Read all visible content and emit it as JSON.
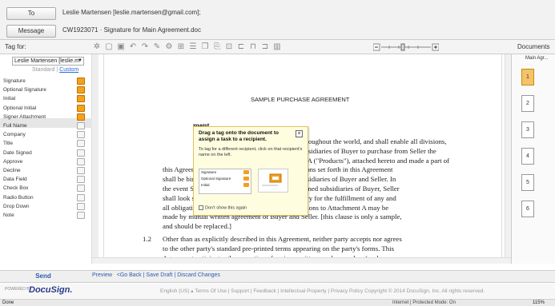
{
  "header": {
    "to_label": "To",
    "to_value": "Leslie Martensen [leslie.martensen@gmail.com];",
    "message_label": "Message",
    "message_value": "CW1923071 · Signature for Main Agreement.doc"
  },
  "toolbar": {
    "tag_for_label": "Tag for:",
    "documents_label": "Documents"
  },
  "left_panel": {
    "recipient_select": "Leslie Martensen [leslie.m",
    "tab_standard": "Standard",
    "tab_custom": "Custom",
    "tags": [
      {
        "label": "Signature",
        "icon": "sign-tag-icon"
      },
      {
        "label": "Optional Signature",
        "icon": "optional-sign-tag-icon"
      },
      {
        "label": "Initial",
        "icon": "initial-tag-icon"
      },
      {
        "label": "Optional Initial",
        "icon": "optional-initial-tag-icon"
      },
      {
        "label": "Signer Attachment",
        "icon": "attachment-tag-icon"
      },
      {
        "label": "Full Name",
        "icon": "fullname-tag-icon"
      },
      {
        "label": "Company",
        "icon": "company-tag-icon"
      },
      {
        "label": "Title",
        "icon": "title-tag-icon"
      },
      {
        "label": "Date Signed",
        "icon": "date-tag-icon"
      },
      {
        "label": "Approve",
        "icon": "approve-tag-icon"
      },
      {
        "label": "Decline",
        "icon": "decline-tag-icon"
      },
      {
        "label": "Data Field",
        "icon": "datafield-tag-icon"
      },
      {
        "label": "Check Box",
        "icon": "checkbox-tag-icon"
      },
      {
        "label": "Radio Button",
        "icon": "radio-tag-icon"
      },
      {
        "label": "Drop Down",
        "icon": "dropdown-tag-icon"
      },
      {
        "label": "Note",
        "icon": "note-tag-icon"
      }
    ]
  },
  "popup": {
    "title": "Drag a tag onto the document to assign a task to a recipient.",
    "body": "To tag for a different recipient, click on that recipient's name on the left.",
    "mini_items": [
      "Signature",
      "Optional Signature",
      "Initial"
    ],
    "dont_show": "Don't show this again"
  },
  "document": {
    "title": "SAMPLE PURCHASE AGREEMENT",
    "section_title": "ment",
    "para1_lines": [
      "ent shall be valid throughout the world, and shall enable all divisions,",
      "d wholly-owned subsidiaries of Buyer to purchase from Seller the",
      "forth in Attachment A (\"Products\"), attached hereto and made a part of",
      "this Agreement.  Accordingly, the terms and conditions set forth in this Agreement",
      "shall be binding on all divisions, locations, and subsidiaries of Buyer and Seller.  In",
      "the event Seller accepts any orders from wholly-owned subsidiaries of Buyer, Seller",
      "shall look solely upon such wholly-owned subsidiary for the fulfillment of any and",
      "all obligations of payment for said order.  Modifications to Attachment A may be",
      "made by mutual written agreement of Buyer and Seller. [this clause is only a sample,",
      "and should be replaced.]"
    ],
    "para2_number": "1.2",
    "para2_lines": [
      "Other than as explicitly described in this Agreement, neither party accepts nor agrees",
      "to the other party's standard pre-printed terms appearing on the party's forms. This",
      "Agreement anticipates the execution of various written purchase orders (each, a"
    ]
  },
  "right_panel": {
    "main_agr": "Main Agr...",
    "pages": [
      "1",
      "2",
      "3",
      "4",
      "5",
      "6"
    ]
  },
  "footer": {
    "send": "Send",
    "preview": "Preview",
    "go_back": "<Go Back",
    "save_draft": "Save Draft",
    "discard": "Discard Changes",
    "powered_by": "POWERED BY",
    "logo": "DocuSign.",
    "links": "English (US) ▴  Terms Of Use  |  Support  |  Feedback  |  Intellectual Property  |  Privacy Policy    Copyright © 2014 DocuSign, Inc. All rights reserved."
  },
  "status_bar": {
    "left": "Done",
    "zone": "Internet | Protected Mode: On",
    "zoom": "115%"
  }
}
